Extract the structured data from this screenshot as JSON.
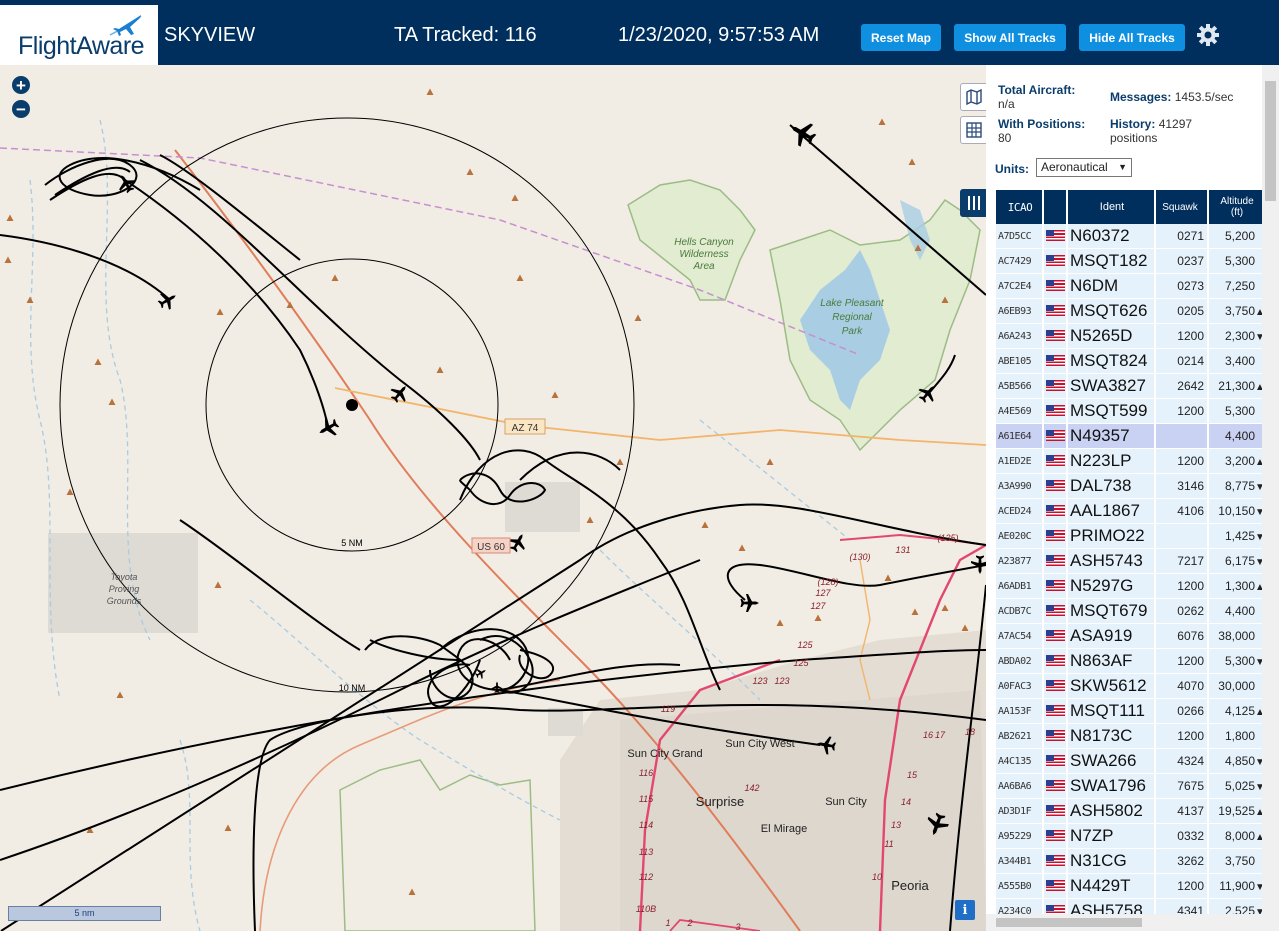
{
  "header": {
    "logo_text": "FlightAware",
    "app_name": "SKYVIEW",
    "tracked": "TA Tracked: 116",
    "datetime": "1/23/2020, 9:57:53 AM",
    "buttons": {
      "reset": "Reset Map",
      "show": "Show All Tracks",
      "hide": "Hide All Tracks"
    }
  },
  "map": {
    "zoom_in": "+",
    "zoom_out": "−",
    "scale_label": "5 nm",
    "info": "i",
    "range_rings": [
      "5 NM",
      "10 NM"
    ],
    "labels": {
      "hells_canyon": [
        "Hells Canyon",
        "Wilderness",
        "Area"
      ],
      "lake_pleasant": [
        "Lake Pleasant",
        "Regional",
        "Park"
      ],
      "toyota": [
        "Toyota",
        "Proving",
        "Grounds"
      ],
      "az74": "AZ 74",
      "us60": "US 60",
      "sun_city_grand": "Sun City Grand",
      "sun_city_west": "Sun City West",
      "sun_city": "Sun City",
      "surprise": "Surprise",
      "el_mirage": "El Mirage",
      "peoria": "Peoria"
    },
    "road_numbers": [
      "(130)",
      "131",
      "(135)",
      "(128)",
      "127",
      "127",
      "125",
      "125",
      "123",
      "123",
      "119",
      "116",
      "115",
      "114",
      "113",
      "112",
      "110B",
      "142",
      "18",
      "17",
      "16",
      "15",
      "14",
      "13",
      "11",
      "10",
      "1",
      "2",
      "3"
    ]
  },
  "stats": {
    "total_label": "Total Aircraft:",
    "total_value": "n/a",
    "positions_label": "With Positions:",
    "positions_value": "80",
    "messages_label": "Messages:",
    "messages_value": "1453.5/sec",
    "history_label": "History:",
    "history_value": "41297",
    "history_unit": "positions",
    "units_label": "Units:",
    "units_value": "Aeronautical"
  },
  "table": {
    "headers": {
      "icao": "ICAO",
      "ident": "Ident",
      "squawk": "Squawk",
      "altitude": "Altitude",
      "altitude_unit": "(ft)"
    },
    "rows": [
      {
        "icao": "A7D5CC",
        "ident": "N60372",
        "squawk": "0271",
        "alt": "5,200",
        "trend": ""
      },
      {
        "icao": "AC7429",
        "ident": "MSQT182",
        "squawk": "0237",
        "alt": "5,300",
        "trend": ""
      },
      {
        "icao": "A7C2E4",
        "ident": "N6DM",
        "squawk": "0273",
        "alt": "7,250",
        "trend": ""
      },
      {
        "icao": "A6EB93",
        "ident": "MSQT626",
        "squawk": "0205",
        "alt": "3,750",
        "trend": "▲"
      },
      {
        "icao": "A6A243",
        "ident": "N5265D",
        "squawk": "1200",
        "alt": "2,300",
        "trend": "▼"
      },
      {
        "icao": "ABE105",
        "ident": "MSQT824",
        "squawk": "0214",
        "alt": "3,400",
        "trend": ""
      },
      {
        "icao": "A5B566",
        "ident": "SWA3827",
        "squawk": "2642",
        "alt": "21,300",
        "trend": "▲"
      },
      {
        "icao": "A4E569",
        "ident": "MSQT599",
        "squawk": "1200",
        "alt": "5,300",
        "trend": ""
      },
      {
        "icao": "A61E64",
        "ident": "N49357",
        "squawk": "",
        "alt": "4,400",
        "trend": ""
      },
      {
        "icao": "A1ED2E",
        "ident": "N223LP",
        "squawk": "1200",
        "alt": "3,200",
        "trend": "▲"
      },
      {
        "icao": "A3A990",
        "ident": "DAL738",
        "squawk": "3146",
        "alt": "8,775",
        "trend": "▼"
      },
      {
        "icao": "ACED24",
        "ident": "AAL1867",
        "squawk": "4106",
        "alt": "10,150",
        "trend": "▼"
      },
      {
        "icao": "AE020C",
        "ident": "PRIMO22",
        "squawk": "",
        "alt": "1,425",
        "trend": "▼"
      },
      {
        "icao": "A23877",
        "ident": "ASH5743",
        "squawk": "7217",
        "alt": "6,175",
        "trend": "▼"
      },
      {
        "icao": "A6ADB1",
        "ident": "N5297G",
        "squawk": "1200",
        "alt": "1,300",
        "trend": "▲"
      },
      {
        "icao": "ACDB7C",
        "ident": "MSQT679",
        "squawk": "0262",
        "alt": "4,400",
        "trend": ""
      },
      {
        "icao": "A7AC54",
        "ident": "ASA919",
        "squawk": "6076",
        "alt": "38,000",
        "trend": ""
      },
      {
        "icao": "ABDA02",
        "ident": "N863AF",
        "squawk": "1200",
        "alt": "5,300",
        "trend": "▼"
      },
      {
        "icao": "A0FAC3",
        "ident": "SKW5612",
        "squawk": "4070",
        "alt": "30,000",
        "trend": ""
      },
      {
        "icao": "AA153F",
        "ident": "MSQT111",
        "squawk": "0266",
        "alt": "4,125",
        "trend": "▲"
      },
      {
        "icao": "AB2621",
        "ident": "N8173C",
        "squawk": "1200",
        "alt": "1,800",
        "trend": ""
      },
      {
        "icao": "A4C135",
        "ident": "SWA266",
        "squawk": "4324",
        "alt": "4,850",
        "trend": "▼"
      },
      {
        "icao": "AA6BA6",
        "ident": "SWA1796",
        "squawk": "7675",
        "alt": "5,025",
        "trend": "▼"
      },
      {
        "icao": "AD3D1F",
        "ident": "ASH5802",
        "squawk": "4137",
        "alt": "19,525",
        "trend": "▲"
      },
      {
        "icao": "A95229",
        "ident": "N7ZP",
        "squawk": "0332",
        "alt": "8,000",
        "trend": "▲"
      },
      {
        "icao": "A344B1",
        "ident": "N31CG",
        "squawk": "3262",
        "alt": "3,750",
        "trend": ""
      },
      {
        "icao": "A555B0",
        "ident": "N4429T",
        "squawk": "1200",
        "alt": "11,900",
        "trend": "▼"
      },
      {
        "icao": "A234C0",
        "ident": "ASH5758",
        "squawk": "4341",
        "alt": "2,525",
        "trend": "▼"
      }
    ],
    "selected_index": 8
  }
}
